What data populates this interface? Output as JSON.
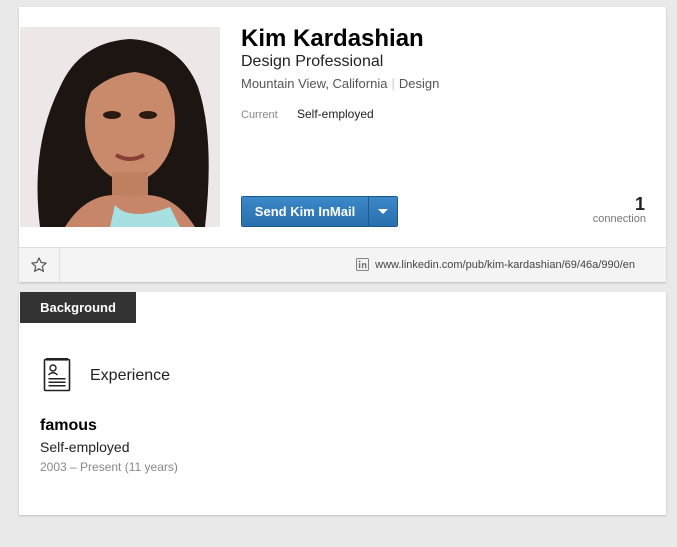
{
  "profile": {
    "name": "Kim Kardashian",
    "headline": "Design Professional",
    "location": "Mountain View, California",
    "industry": "Design",
    "current_label": "Current",
    "current_value": "Self-employed",
    "inmail_label": "Send Kim InMail",
    "connection_count": "1",
    "connection_label": "connection",
    "public_url": "www.linkedin.com/pub/kim-kardashian/69/46a/990/en"
  },
  "background": {
    "tab_label": "Background",
    "section_title": "Experience",
    "job_title": "famous",
    "job_company": "Self-employed",
    "job_dates": "2003 – Present (11 years)"
  },
  "colors": {
    "accent": "#2a6fad",
    "tab_bg": "#333333",
    "page_bg": "#e9e9e9"
  },
  "icons": {
    "star": "star-icon",
    "linkedin": "linkedin-icon",
    "experience": "resume-icon",
    "dropdown": "chevron-down-icon"
  }
}
